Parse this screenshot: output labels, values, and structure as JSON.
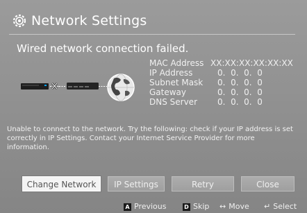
{
  "window": {
    "title": "Network Settings"
  },
  "status": "Wired network connection failed.",
  "info": [
    {
      "label": "MAC Address",
      "value": "XX:XX:XX:XX:XX:XX"
    },
    {
      "label": "IP Address",
      "value": "0.  0.  0.  0"
    },
    {
      "label": "Subnet Mask",
      "value": "0.  0.  0.  0"
    },
    {
      "label": "Gateway",
      "value": "0.  0.  0.  0"
    },
    {
      "label": "DNS Server",
      "value": "0.  0.  0.  0"
    }
  ],
  "help_text": "Unable to connect to the network. Try the following: check if your IP address is set correctly in IP Settings. Contact your Internet Service Provider for more information.",
  "buttons": {
    "change_network": "Change Network",
    "ip_settings": "IP Settings",
    "retry": "Retry",
    "close": "Close"
  },
  "footer": {
    "previous": {
      "key": "A",
      "label": "Previous"
    },
    "skip": {
      "key": "D",
      "label": "Skip"
    },
    "move": {
      "glyph": "↔",
      "label": "Move"
    },
    "select": {
      "glyph": "↵",
      "label": "Select"
    }
  },
  "icons": {
    "settings": "gear-icon",
    "device": "player-icon",
    "failed_link": "x-icon",
    "router": "router-icon",
    "internet": "globe-icon"
  }
}
